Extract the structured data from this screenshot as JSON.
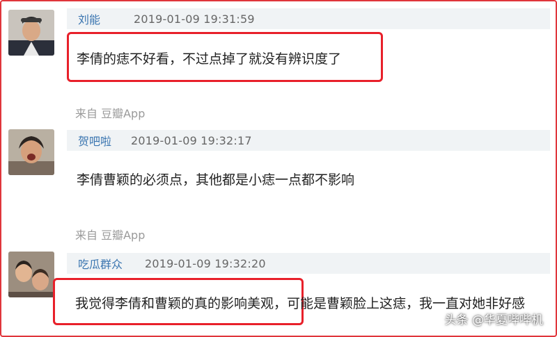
{
  "comments": [
    {
      "user": "刘能",
      "time": "2019-01-09 19:31:59",
      "text": "李倩的痣不好看，不过点掉了就没有辨识度了",
      "source_prefix": "来自",
      "source_app": "豆瓣App"
    },
    {
      "user": "贺吧啦",
      "time": "2019-01-09 19:32:17",
      "text": "李倩曹颖的必须点，其他都是小痣一点都不影响",
      "source_prefix": "来自",
      "source_app": "豆瓣App"
    },
    {
      "user": "吃瓜群众",
      "time": "2019-01-09 19:32:20",
      "text": "我觉得李倩和曹颖的真的影响美观，可能是曹颖脸上这痣，我一直对她非好感"
    }
  ],
  "watermark": "头条 @华夏哔哔机",
  "colors": {
    "frame": "#e0353b",
    "highlight": "#e8202a",
    "username": "#3a75b0",
    "meta_bar": "#f0f3f5"
  }
}
